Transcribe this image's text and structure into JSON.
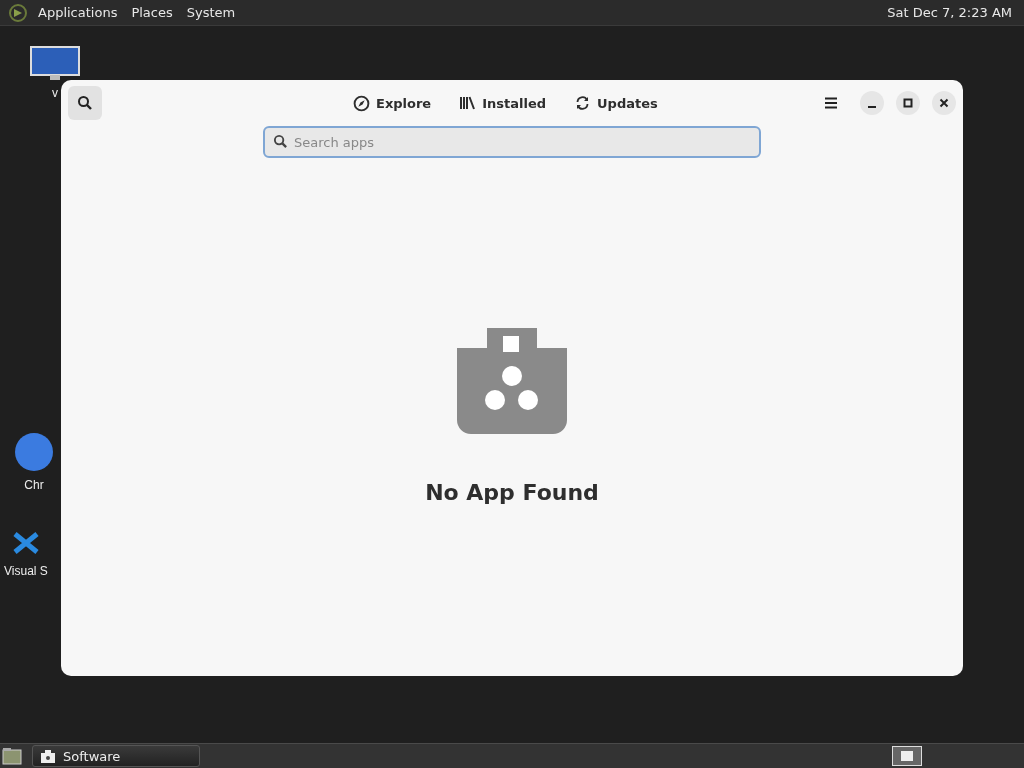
{
  "top_panel": {
    "menus": [
      "Applications",
      "Places",
      "System"
    ],
    "clock": "Sat Dec 7, 2:23 AM"
  },
  "desktop_icons": [
    {
      "kind": "monitor",
      "label": "v"
    },
    {
      "kind": "browser",
      "label": "Chr"
    },
    {
      "kind": "code",
      "label": "Visual S"
    }
  ],
  "window": {
    "tabs": [
      {
        "kind": "explore",
        "label": "Explore",
        "selected": false
      },
      {
        "kind": "installed",
        "label": "Installed",
        "selected": false
      },
      {
        "kind": "updates",
        "label": "Updates",
        "selected": false
      }
    ],
    "search": {
      "placeholder": "Search apps",
      "focused": true
    },
    "empty_state": {
      "title": "No App Found"
    }
  },
  "taskbar": {
    "tasks": [
      {
        "label": "Software",
        "selected": false
      }
    ]
  }
}
